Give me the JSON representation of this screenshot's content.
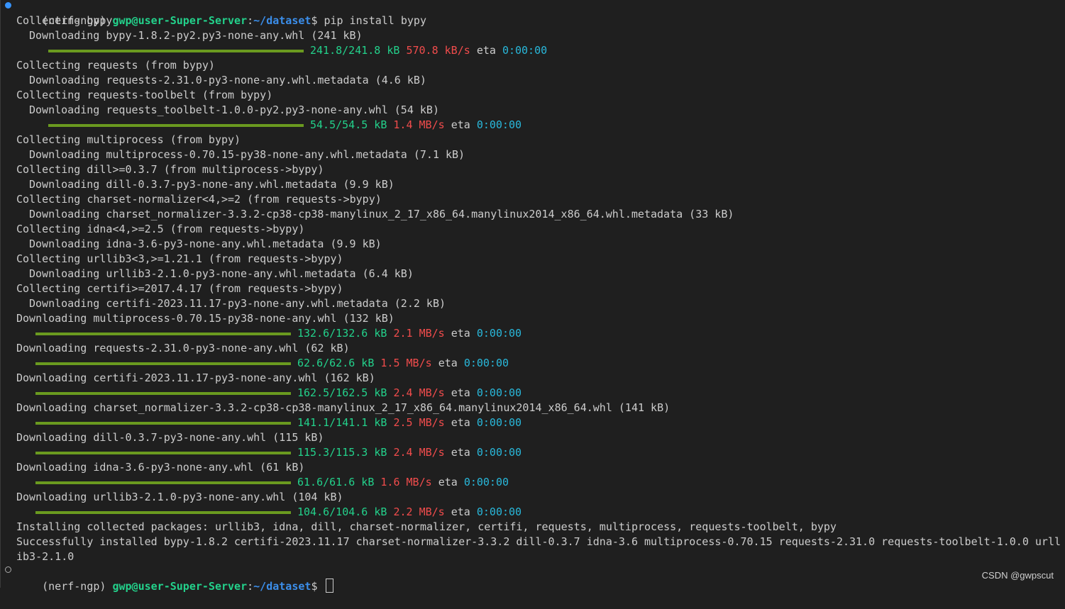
{
  "prompt": {
    "env": "(nerf-ngp) ",
    "user_host": "gwp@user-Super-Server",
    "colon": ":",
    "path": "~/dataset",
    "dollar": "$ "
  },
  "command": "pip install bypy",
  "output": [
    {
      "text": "Collecting bypy",
      "indent": 1
    },
    {
      "text": "Downloading bypy-1.8.2-py2.py3-none-any.whl (241 kB)",
      "indent": 2
    },
    {
      "progress": {
        "size": "241.8/241.8 kB",
        "speed": "570.8 kB/s",
        "eta_label": "eta",
        "eta": "0:00:00",
        "fraction": 1.0
      },
      "indent": 2
    },
    {
      "text": "Collecting requests (from bypy)",
      "indent": 1
    },
    {
      "text": "Downloading requests-2.31.0-py3-none-any.whl.metadata (4.6 kB)",
      "indent": 2
    },
    {
      "text": "Collecting requests-toolbelt (from bypy)",
      "indent": 1
    },
    {
      "text": "Downloading requests_toolbelt-1.0.0-py2.py3-none-any.whl (54 kB)",
      "indent": 2
    },
    {
      "progress": {
        "size": "54.5/54.5 kB",
        "speed": "1.4 MB/s",
        "eta_label": "eta",
        "eta": "0:00:00",
        "fraction": 1.0
      },
      "indent": 2
    },
    {
      "text": "Collecting multiprocess (from bypy)",
      "indent": 1
    },
    {
      "text": "Downloading multiprocess-0.70.15-py38-none-any.whl.metadata (7.1 kB)",
      "indent": 2
    },
    {
      "text": "Collecting dill>=0.3.7 (from multiprocess->bypy)",
      "indent": 1
    },
    {
      "text": "Downloading dill-0.3.7-py3-none-any.whl.metadata (9.9 kB)",
      "indent": 2
    },
    {
      "text": "Collecting charset-normalizer<4,>=2 (from requests->bypy)",
      "indent": 1
    },
    {
      "text": "Downloading charset_normalizer-3.3.2-cp38-cp38-manylinux_2_17_x86_64.manylinux2014_x86_64.whl.metadata (33 kB)",
      "indent": 2
    },
    {
      "text": "Collecting idna<4,>=2.5 (from requests->bypy)",
      "indent": 1
    },
    {
      "text": "Downloading idna-3.6-py3-none-any.whl.metadata (9.9 kB)",
      "indent": 2
    },
    {
      "text": "Collecting urllib3<3,>=1.21.1 (from requests->bypy)",
      "indent": 1
    },
    {
      "text": "Downloading urllib3-2.1.0-py3-none-any.whl.metadata (6.4 kB)",
      "indent": 2
    },
    {
      "text": "Collecting certifi>=2017.4.17 (from requests->bypy)",
      "indent": 1
    },
    {
      "text": "Downloading certifi-2023.11.17-py3-none-any.whl.metadata (2.2 kB)",
      "indent": 2
    },
    {
      "text": "Downloading multiprocess-0.70.15-py38-none-any.whl (132 kB)",
      "indent": 1
    },
    {
      "progress": {
        "size": "132.6/132.6 kB",
        "speed": "2.1 MB/s",
        "eta_label": "eta",
        "eta": "0:00:00",
        "fraction": 1.0
      },
      "indent": 1
    },
    {
      "text": "Downloading requests-2.31.0-py3-none-any.whl (62 kB)",
      "indent": 1
    },
    {
      "progress": {
        "size": "62.6/62.6 kB",
        "speed": "1.5 MB/s",
        "eta_label": "eta",
        "eta": "0:00:00",
        "fraction": 1.0
      },
      "indent": 1
    },
    {
      "text": "Downloading certifi-2023.11.17-py3-none-any.whl (162 kB)",
      "indent": 1
    },
    {
      "progress": {
        "size": "162.5/162.5 kB",
        "speed": "2.4 MB/s",
        "eta_label": "eta",
        "eta": "0:00:00",
        "fraction": 1.0
      },
      "indent": 1
    },
    {
      "text": "Downloading charset_normalizer-3.3.2-cp38-cp38-manylinux_2_17_x86_64.manylinux2014_x86_64.whl (141 kB)",
      "indent": 1
    },
    {
      "progress": {
        "size": "141.1/141.1 kB",
        "speed": "2.5 MB/s",
        "eta_label": "eta",
        "eta": "0:00:00",
        "fraction": 1.0
      },
      "indent": 1
    },
    {
      "text": "Downloading dill-0.3.7-py3-none-any.whl (115 kB)",
      "indent": 1
    },
    {
      "progress": {
        "size": "115.3/115.3 kB",
        "speed": "2.4 MB/s",
        "eta_label": "eta",
        "eta": "0:00:00",
        "fraction": 1.0
      },
      "indent": 1
    },
    {
      "text": "Downloading idna-3.6-py3-none-any.whl (61 kB)",
      "indent": 1
    },
    {
      "progress": {
        "size": "61.6/61.6 kB",
        "speed": "1.6 MB/s",
        "eta_label": "eta",
        "eta": "0:00:00",
        "fraction": 1.0
      },
      "indent": 1
    },
    {
      "text": "Downloading urllib3-2.1.0-py3-none-any.whl (104 kB)",
      "indent": 1
    },
    {
      "progress": {
        "size": "104.6/104.6 kB",
        "speed": "2.2 MB/s",
        "eta_label": "eta",
        "eta": "0:00:00",
        "fraction": 1.0
      },
      "indent": 1
    },
    {
      "text": "Installing collected packages: urllib3, idna, dill, charset-normalizer, certifi, requests, multiprocess, requests-toolbelt, bypy",
      "indent": 1
    },
    {
      "text": "Successfully installed bypy-1.8.2 certifi-2023.11.17 charset-normalizer-3.3.2 dill-0.3.7 idna-3.6 multiprocess-0.70.15 requests-2.31.0 requests-toolbelt-1.0.0 urll",
      "indent": 1
    },
    {
      "text": "ib3-2.1.0",
      "indent": 1
    }
  ],
  "watermark": "CSDN @gwpscut",
  "colors": {
    "background": "#1f1f1f",
    "text": "#cccccc",
    "prompt_user": "#23d18b",
    "prompt_path": "#3b8eea",
    "progress_size": "#23d18b",
    "progress_speed": "#f14c4c",
    "progress_eta": "#29b8db",
    "progress_bar": "#6a9a1f"
  }
}
